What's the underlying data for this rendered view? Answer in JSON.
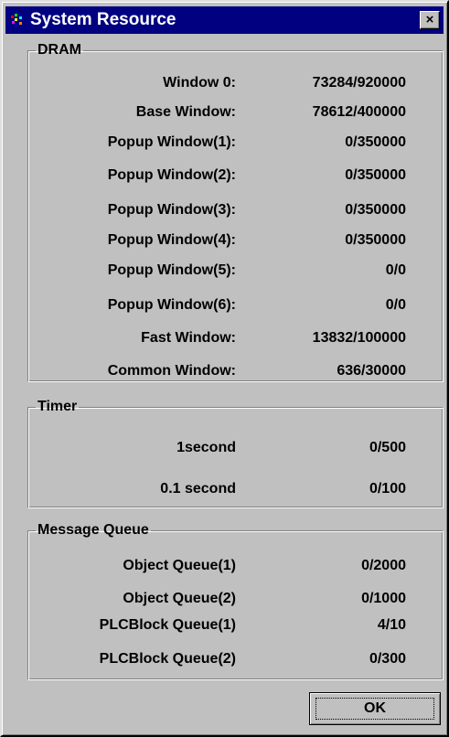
{
  "window": {
    "title": "System Resource",
    "close_label": "×",
    "icon": "app-icon"
  },
  "dram": {
    "legend": "DRAM",
    "rows": [
      {
        "label": "Window 0:",
        "value": "73284/920000"
      },
      {
        "label": "Base Window:",
        "value": "78612/400000"
      },
      {
        "label": "Popup Window(1):",
        "value": "0/350000"
      },
      {
        "label": "Popup Window(2):",
        "value": "0/350000"
      },
      {
        "label": "Popup Window(3):",
        "value": "0/350000"
      },
      {
        "label": "Popup Window(4):",
        "value": "0/350000"
      },
      {
        "label": "Popup Window(5):",
        "value": "0/0"
      },
      {
        "label": "Popup Window(6):",
        "value": "0/0"
      },
      {
        "label": "Fast Window:",
        "value": "13832/100000"
      },
      {
        "label": "Common Window:",
        "value": "636/30000"
      }
    ]
  },
  "timer": {
    "legend": "Timer",
    "rows": [
      {
        "label": "1second",
        "value": "0/500"
      },
      {
        "label": "0.1 second",
        "value": "0/100"
      }
    ]
  },
  "message_queue": {
    "legend": "Message Queue",
    "rows": [
      {
        "label": "Object Queue(1)",
        "value": "0/2000"
      },
      {
        "label": "Object Queue(2)",
        "value": "0/1000"
      },
      {
        "label": "PLCBlock Queue(1)",
        "value": "4/10"
      },
      {
        "label": "PLCBlock Queue(2)",
        "value": "0/300"
      }
    ]
  },
  "buttons": {
    "ok_label": "OK"
  },
  "colors": {
    "titlebar": "#000080",
    "face": "#c0c0c0"
  }
}
